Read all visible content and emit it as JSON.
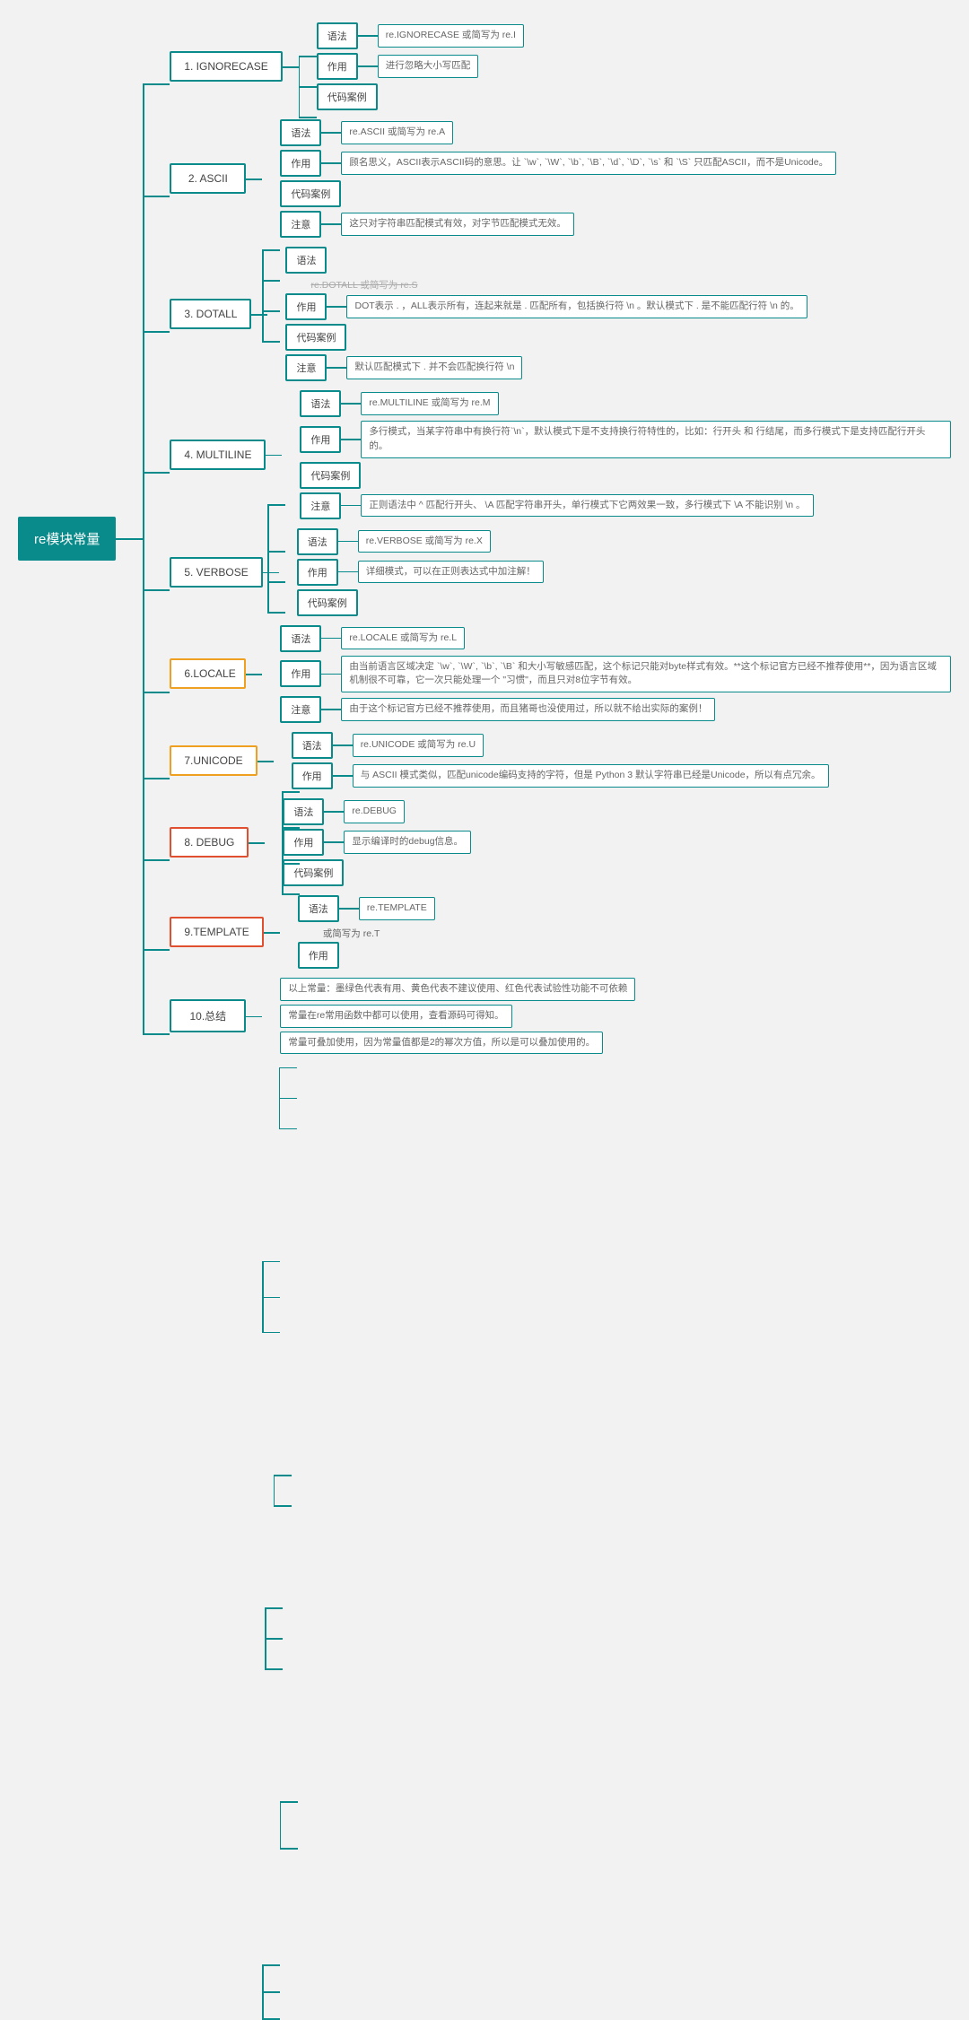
{
  "root": "re模块常量",
  "labels": {
    "syntax": "语法",
    "effect": "作用",
    "example": "代码案例",
    "note": "注意"
  },
  "items": [
    {
      "title": "1. IGNORECASE",
      "color": "teal",
      "rows": [
        {
          "k": "syntax",
          "v": "re.IGNORECASE 或简写为 re.I"
        },
        {
          "k": "effect",
          "v": "进行忽略大小写匹配"
        },
        {
          "k": "example"
        }
      ]
    },
    {
      "title": "2. ASCII",
      "color": "teal",
      "rows": [
        {
          "k": "syntax",
          "v": "re.ASCII 或简写为 re.A"
        },
        {
          "k": "effect",
          "v": "顾名思义，ASCII表示ASCII码的意思。让 `\\w`, `\\W`, `\\b`, `\\B`, `\\d`, `\\D`, `\\s` 和 `\\S` 只匹配ASCII，而不是Unicode。"
        },
        {
          "k": "example"
        },
        {
          "k": "note",
          "v": "这只对字符串匹配模式有效，对字节匹配模式无效。"
        }
      ]
    },
    {
      "title": "3. DOTALL",
      "color": "teal",
      "rows": [
        {
          "k": "syntax",
          "extra": "re.DOTALL 或简写为 re.S",
          "strike": true
        },
        {
          "k": "effect",
          "v": "DOT表示 . ，ALL表示所有，连起来就是 . 匹配所有，包括换行符 \\n 。默认模式下 . 是不能匹配行符 \\n 的。"
        },
        {
          "k": "example"
        },
        {
          "k": "note",
          "v": "默认匹配模式下 . 并不会匹配换行符 \\n"
        }
      ]
    },
    {
      "title": "4. MULTILINE",
      "color": "teal",
      "rows": [
        {
          "k": "syntax",
          "v": "re.MULTILINE 或简写为 re.M"
        },
        {
          "k": "effect",
          "v": "多行模式，当某字符串中有换行符`\\n`，默认模式下是不支持换行符特性的，比如：行开头 和 行结尾，而多行模式下是支持匹配行开头的。"
        },
        {
          "k": "example"
        },
        {
          "k": "note",
          "v": "正则语法中 ^ 匹配行开头、 \\A 匹配字符串开头，单行模式下它两效果一致，多行模式下 \\A 不能识别 \\n 。"
        }
      ]
    },
    {
      "title": "5. VERBOSE",
      "color": "teal",
      "rows": [
        {
          "k": "syntax",
          "v": "re.VERBOSE 或简写为 re.X"
        },
        {
          "k": "effect",
          "v": "详细模式，可以在正则表达式中加注解！"
        },
        {
          "k": "example"
        }
      ]
    },
    {
      "title": "6.LOCALE",
      "color": "yellow",
      "rows": [
        {
          "k": "syntax",
          "v": "re.LOCALE 或简写为 re.L"
        },
        {
          "k": "effect",
          "v": "由当前语言区域决定 `\\w`, `\\W`, `\\b`, `\\B` 和大小写敏感匹配，这个标记只能对byte样式有效。**这个标记官方已经不推荐使用**，因为语言区域机制很不可靠，它一次只能处理一个 \"习惯\"，而且只对8位字节有效。"
        },
        {
          "k": "note",
          "v": "由于这个标记官方已经不推荐使用，而且猪哥也没使用过，所以就不给出实际的案例！"
        }
      ]
    },
    {
      "title": "7.UNICODE",
      "color": "yellow",
      "rows": [
        {
          "k": "syntax",
          "v": "re.UNICODE 或简写为 re.U"
        },
        {
          "k": "effect",
          "v": "与 ASCII 模式类似，匹配unicode编码支持的字符，但是 Python 3 默认字符串已经是Unicode，所以有点冗余。"
        }
      ]
    },
    {
      "title": "8. DEBUG",
      "color": "red",
      "rows": [
        {
          "k": "syntax",
          "v": "re.DEBUG"
        },
        {
          "k": "effect",
          "v": "显示编译时的debug信息。"
        },
        {
          "k": "example"
        }
      ]
    },
    {
      "title": "9.TEMPLATE",
      "color": "red",
      "rows": [
        {
          "k": "syntax",
          "v": "re.TEMPLATE",
          "extra": "或简写为 re.T"
        },
        {
          "k": "effect"
        }
      ]
    },
    {
      "title": "10.总结",
      "color": "teal",
      "plain": [
        "以上常量：墨绿色代表有用、黄色代表不建议使用、红色代表试验性功能不可依赖",
        "常量在re常用函数中都可以使用，查看源码可得知。",
        "常量可叠加使用，因为常量值都是2的幂次方值，所以是可以叠加使用的。"
      ]
    }
  ]
}
